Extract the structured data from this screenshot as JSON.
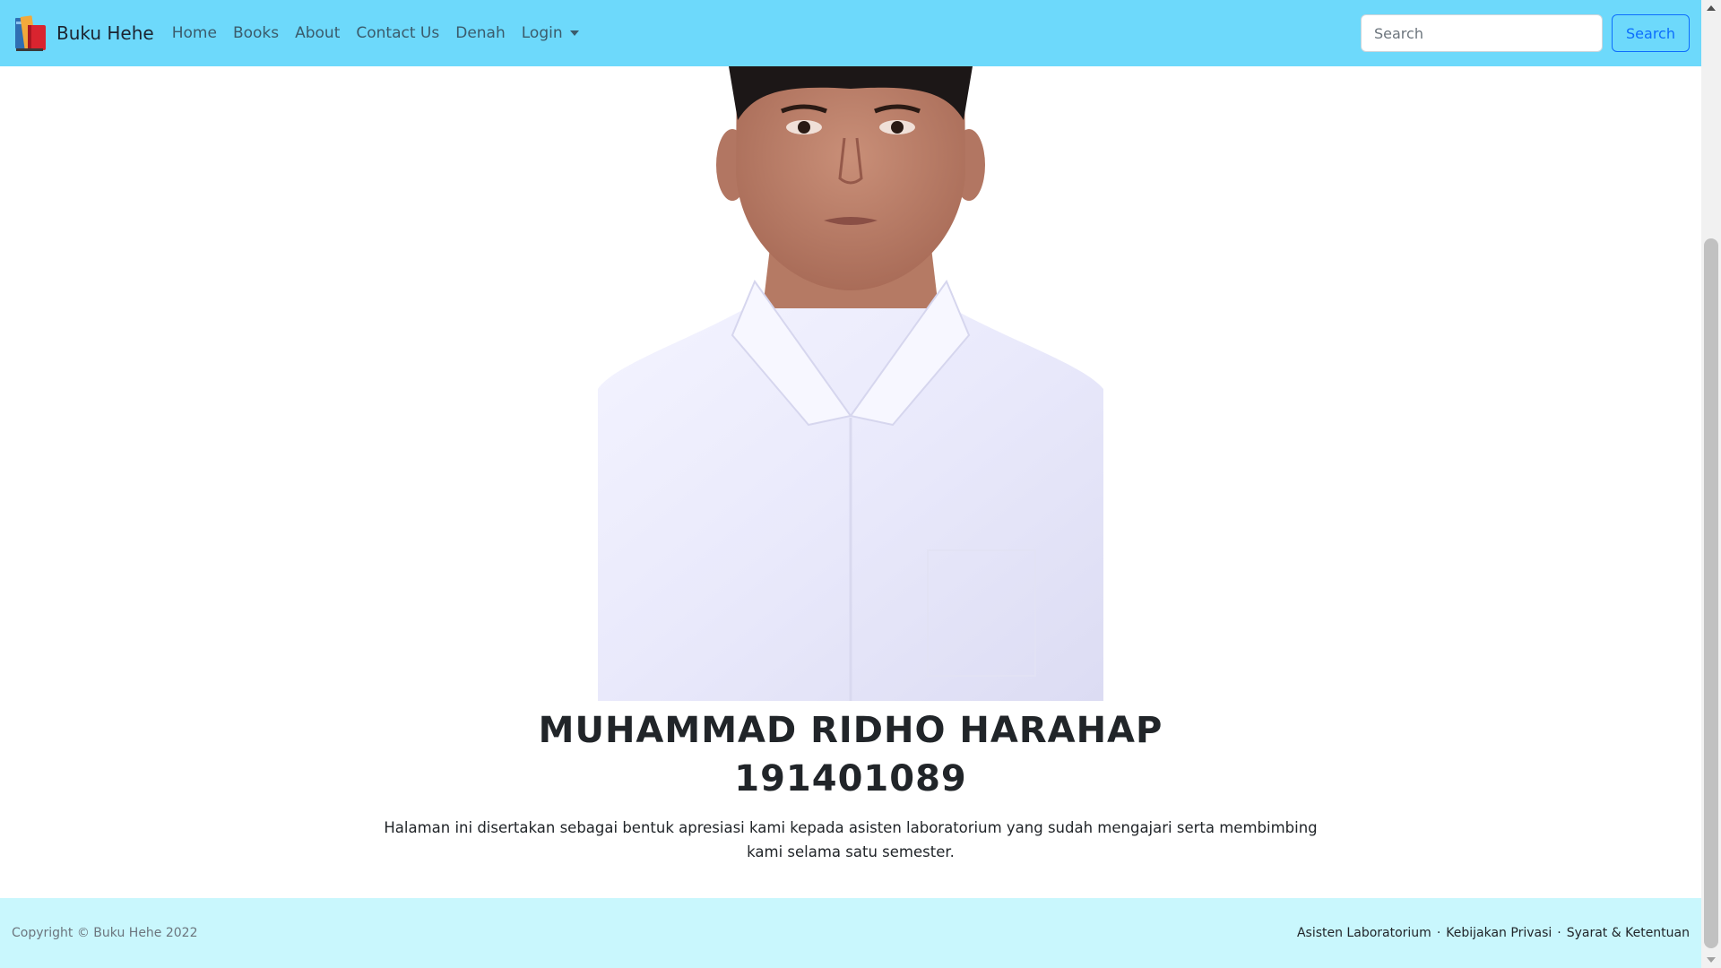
{
  "navbar": {
    "brand": "Buku Hehe",
    "links": [
      "Home",
      "Books",
      "About",
      "Contact Us",
      "Denah"
    ],
    "login": "Login",
    "search_placeholder": "Search",
    "search_button": "Search",
    "background": "#6dd9fb"
  },
  "profile": {
    "name": "MUHAMMAD RIDHO HARAHAP",
    "nim": "191401089",
    "description": "Halaman ini disertakan sebagai bentuk apresiasi kami kepada asisten laboratorium yang sudah mengajari serta membimbing kami selama satu semester."
  },
  "footer": {
    "copyright": "Copyright © Buku Hehe 2022",
    "links": [
      "Asisten Laboratorium",
      "Kebijakan Privasi",
      "Syarat & Ketentuan"
    ],
    "separator": "·",
    "background": "#c9f7fd"
  },
  "icons": {
    "brand": "books-logo-icon",
    "dropdown": "caret-down-icon"
  }
}
